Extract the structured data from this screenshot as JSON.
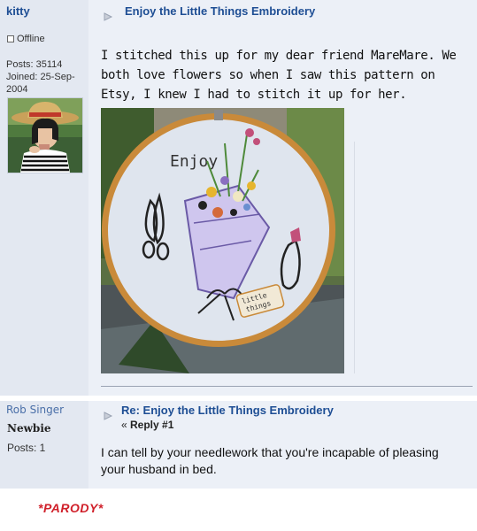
{
  "post1": {
    "author": "kitty",
    "status": "Offline",
    "posts": "Posts: 35114",
    "joined_line1": "Joined: 25-Sep-",
    "joined_line2": "2004",
    "title": "Enjoy the Little Things Embroidery",
    "body": "I stitched this up for my dear friend MareMare. We both love flowers so when I saw this pattern on Etsy, I knew I had to stitch it up for her.",
    "photo": {
      "hoop_text_top": "Enjoy",
      "tag_line1": "little",
      "tag_line2": "things"
    }
  },
  "post2": {
    "author": "Rob Singer",
    "rank": "Newbie",
    "posts": "Posts: 1",
    "title": "Re: Enjoy the Little Things Embroidery",
    "reply_prefix": "« ",
    "reply_label": "Reply #1",
    "body": "I can tell by your needlework that you're incapable of pleasing your husband in bed."
  },
  "footer": {
    "parody": "*PARODY*"
  },
  "colors": {
    "link": "#1e4e94",
    "post_bg": "#ecf0f7",
    "sidebar_bg": "#e3e8f1",
    "parody": "#d0202a"
  }
}
